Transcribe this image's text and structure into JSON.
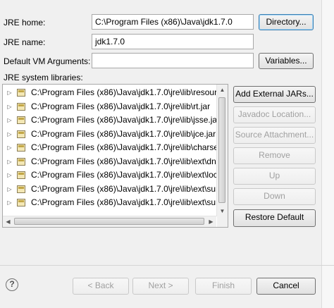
{
  "form": {
    "jre_home_label": "JRE home:",
    "jre_home_value": "C:\\Program Files (x86)\\Java\\jdk1.7.0",
    "directory_button": "Directory...",
    "jre_name_label": "JRE name:",
    "jre_name_value": "jdk1.7.0",
    "vm_args_label": "Default VM Arguments:",
    "vm_args_value": "",
    "variables_button": "Variables...",
    "libraries_label": "JRE system libraries:"
  },
  "libraries": [
    "C:\\Program Files (x86)\\Java\\jdk1.7.0\\jre\\lib\\resour",
    "C:\\Program Files (x86)\\Java\\jdk1.7.0\\jre\\lib\\rt.jar",
    "C:\\Program Files (x86)\\Java\\jdk1.7.0\\jre\\lib\\jsse.jar",
    "C:\\Program Files (x86)\\Java\\jdk1.7.0\\jre\\lib\\jce.jar",
    "C:\\Program Files (x86)\\Java\\jdk1.7.0\\jre\\lib\\charse",
    "C:\\Program Files (x86)\\Java\\jdk1.7.0\\jre\\lib\\ext\\dn",
    "C:\\Program Files (x86)\\Java\\jdk1.7.0\\jre\\lib\\ext\\loc",
    "C:\\Program Files (x86)\\Java\\jdk1.7.0\\jre\\lib\\ext\\sur",
    "C:\\Program Files (x86)\\Java\\jdk1.7.0\\jre\\lib\\ext\\sur"
  ],
  "side_buttons": {
    "add_external_jars": "Add External JARs...",
    "javadoc_location": "Javadoc Location...",
    "source_attachment": "Source Attachment...",
    "remove": "Remove",
    "up": "Up",
    "down": "Down",
    "restore_default": "Restore Default"
  },
  "footer": {
    "help_icon": "question-mark-icon",
    "back": "< Back",
    "next": "Next >",
    "finish": "Finish",
    "cancel": "Cancel"
  },
  "colors": {
    "dialog_bg": "#f0f0f0",
    "focus_border": "#3c7fb1",
    "disabled_text": "#a0a0a0"
  }
}
